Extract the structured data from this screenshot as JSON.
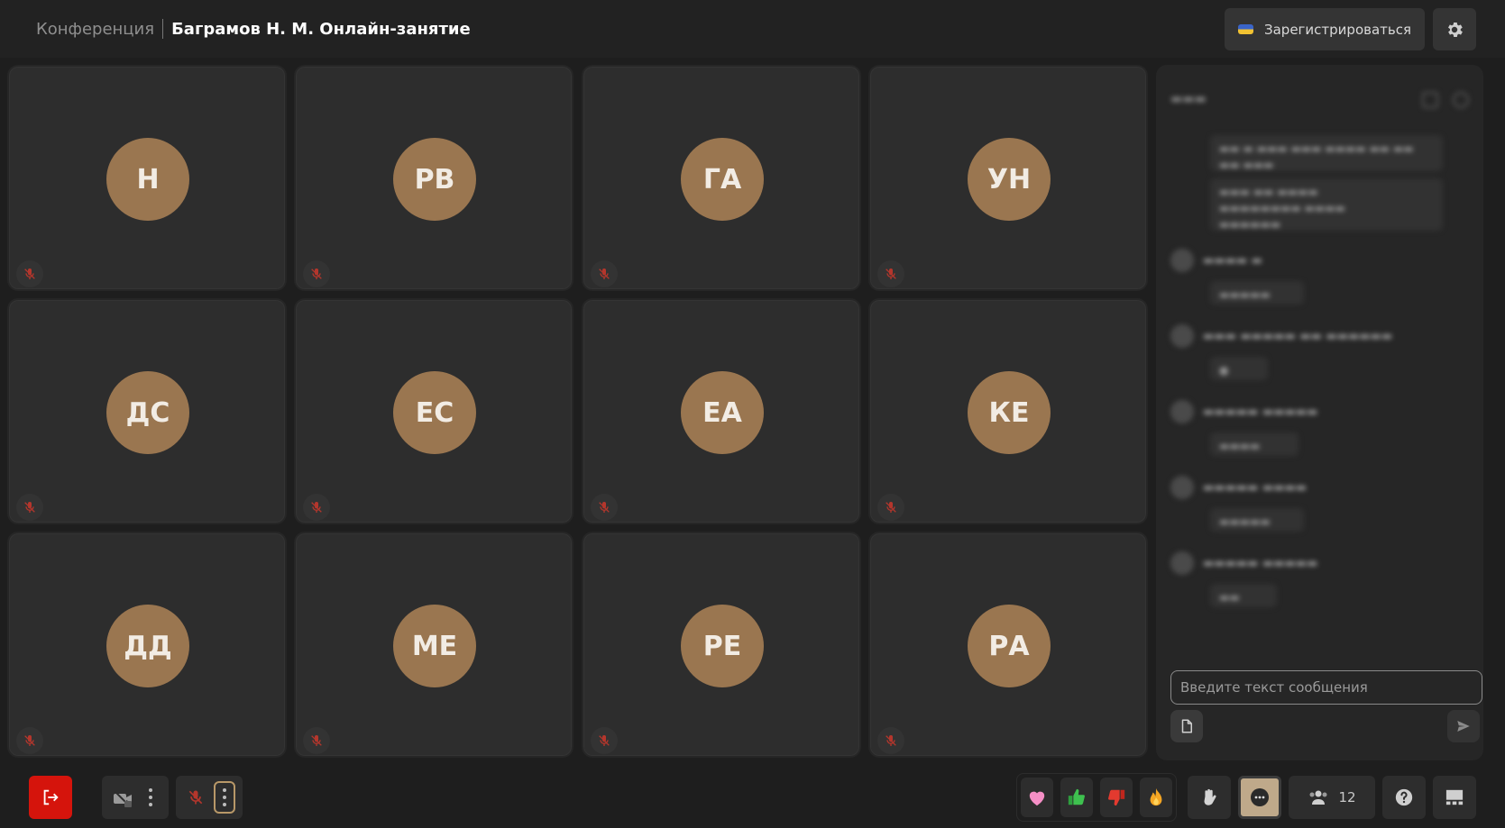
{
  "header": {
    "conference_label": "Конференция",
    "conference_title": "Баграмов Н. М. Онлайн-занятие",
    "register_label": "Зарегистрироваться",
    "register_icon": "flag-icon",
    "settings_icon": "gear-icon"
  },
  "participants": [
    {
      "initials": "Н",
      "muted": true
    },
    {
      "initials": "РВ",
      "muted": true
    },
    {
      "initials": "ГА",
      "muted": true
    },
    {
      "initials": "УН",
      "muted": true
    },
    {
      "initials": "ДС",
      "muted": true
    },
    {
      "initials": "ЕС",
      "muted": true
    },
    {
      "initials": "ЕА",
      "muted": true
    },
    {
      "initials": "КЕ",
      "muted": true
    },
    {
      "initials": "ДД",
      "muted": true
    },
    {
      "initials": "МЕ",
      "muted": true
    },
    {
      "initials": "РЕ",
      "muted": true
    },
    {
      "initials": "РА",
      "muted": true
    }
  ],
  "chat": {
    "input_placeholder": "Введите текст сообщения",
    "attach_icon": "file-icon",
    "send_icon": "send-icon"
  },
  "toolbar": {
    "leave_icon": "exit-icon",
    "camera_icon": "camera-off-icon",
    "mic_icon": "mic-off-icon",
    "reactions": [
      "heart-icon",
      "thumbs-up-icon",
      "thumbs-down-icon",
      "fire-icon"
    ],
    "hand_icon": "raise-hand-icon",
    "chat_icon": "chat-icon",
    "participants_icon": "people-icon",
    "participants_count": "12",
    "help_icon": "help-icon",
    "layout_icon": "layout-icon"
  },
  "colors": {
    "avatar_bg": "#9a7650",
    "leave_red": "#d5140c",
    "muted_red": "#c0392b",
    "chat_active": "#bfa98a"
  }
}
